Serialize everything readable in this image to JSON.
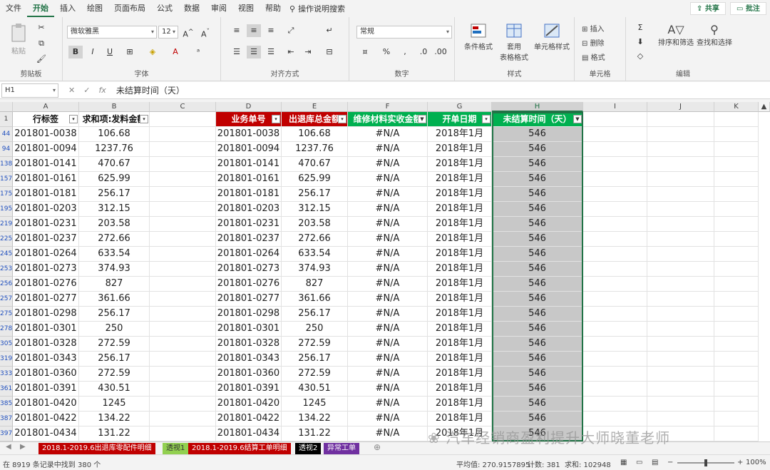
{
  "menu": {
    "items": [
      "文件",
      "开始",
      "插入",
      "绘图",
      "页面布局",
      "公式",
      "数据",
      "审阅",
      "视图",
      "帮助"
    ],
    "search": "操作说明搜索",
    "share": "共享",
    "comment": "批注"
  },
  "ribbon": {
    "paste": "粘贴",
    "font_name": "微软雅黑",
    "font_size": "12",
    "number_format": "常规",
    "cond_format": "条件格式",
    "table_format_1": "套用",
    "table_format_2": "表格格式",
    "cell_style": "单元格样式",
    "insert": "插入",
    "delete": "删除",
    "format": "格式",
    "sort_filter": "排序和筛选",
    "find_select": "查找和选择",
    "groups": {
      "clipboard": "剪贴板",
      "font": "字体",
      "alignment": "对齐方式",
      "number": "数字",
      "styles": "样式",
      "cells": "单元格",
      "editing": "编辑"
    }
  },
  "formula_bar": {
    "name_box": "H1",
    "formula": "未结算时间（天）"
  },
  "grid": {
    "columns": [
      "A",
      "B",
      "C",
      "D",
      "E",
      "F",
      "G",
      "H",
      "I",
      "J",
      "K"
    ],
    "headers": {
      "a": "行标签",
      "b": "求和项:发料金额",
      "d": "业务单号",
      "e": "出退库总金额",
      "f": "维修材料实收金额",
      "g": "开单日期",
      "h": "未结算时间（天）"
    },
    "row_numbers": [
      "1",
      "44",
      "94",
      "138",
      "157",
      "175",
      "195",
      "219",
      "225",
      "245",
      "253",
      "256",
      "257",
      "275",
      "278",
      "305",
      "319",
      "333",
      "361",
      "385",
      "387",
      "397"
    ],
    "rows": [
      {
        "a": "201801-0038",
        "b": "106.68",
        "d": "201801-0038",
        "e": "106.68",
        "f": "#N/A",
        "g": "2018年1月",
        "h": "546"
      },
      {
        "a": "201801-0094",
        "b": "1237.76",
        "d": "201801-0094",
        "e": "1237.76",
        "f": "#N/A",
        "g": "2018年1月",
        "h": "546"
      },
      {
        "a": "201801-0141",
        "b": "470.67",
        "d": "201801-0141",
        "e": "470.67",
        "f": "#N/A",
        "g": "2018年1月",
        "h": "546"
      },
      {
        "a": "201801-0161",
        "b": "625.99",
        "d": "201801-0161",
        "e": "625.99",
        "f": "#N/A",
        "g": "2018年1月",
        "h": "546"
      },
      {
        "a": "201801-0181",
        "b": "256.17",
        "d": "201801-0181",
        "e": "256.17",
        "f": "#N/A",
        "g": "2018年1月",
        "h": "546"
      },
      {
        "a": "201801-0203",
        "b": "312.15",
        "d": "201801-0203",
        "e": "312.15",
        "f": "#N/A",
        "g": "2018年1月",
        "h": "546"
      },
      {
        "a": "201801-0231",
        "b": "203.58",
        "d": "201801-0231",
        "e": "203.58",
        "f": "#N/A",
        "g": "2018年1月",
        "h": "546"
      },
      {
        "a": "201801-0237",
        "b": "272.66",
        "d": "201801-0237",
        "e": "272.66",
        "f": "#N/A",
        "g": "2018年1月",
        "h": "546"
      },
      {
        "a": "201801-0264",
        "b": "633.54",
        "d": "201801-0264",
        "e": "633.54",
        "f": "#N/A",
        "g": "2018年1月",
        "h": "546"
      },
      {
        "a": "201801-0273",
        "b": "374.93",
        "d": "201801-0273",
        "e": "374.93",
        "f": "#N/A",
        "g": "2018年1月",
        "h": "546"
      },
      {
        "a": "201801-0276",
        "b": "827",
        "d": "201801-0276",
        "e": "827",
        "f": "#N/A",
        "g": "2018年1月",
        "h": "546"
      },
      {
        "a": "201801-0277",
        "b": "361.66",
        "d": "201801-0277",
        "e": "361.66",
        "f": "#N/A",
        "g": "2018年1月",
        "h": "546"
      },
      {
        "a": "201801-0298",
        "b": "256.17",
        "d": "201801-0298",
        "e": "256.17",
        "f": "#N/A",
        "g": "2018年1月",
        "h": "546"
      },
      {
        "a": "201801-0301",
        "b": "250",
        "d": "201801-0301",
        "e": "250",
        "f": "#N/A",
        "g": "2018年1月",
        "h": "546"
      },
      {
        "a": "201801-0328",
        "b": "272.59",
        "d": "201801-0328",
        "e": "272.59",
        "f": "#N/A",
        "g": "2018年1月",
        "h": "546"
      },
      {
        "a": "201801-0343",
        "b": "256.17",
        "d": "201801-0343",
        "e": "256.17",
        "f": "#N/A",
        "g": "2018年1月",
        "h": "546"
      },
      {
        "a": "201801-0360",
        "b": "272.59",
        "d": "201801-0360",
        "e": "272.59",
        "f": "#N/A",
        "g": "2018年1月",
        "h": "546"
      },
      {
        "a": "201801-0391",
        "b": "430.51",
        "d": "201801-0391",
        "e": "430.51",
        "f": "#N/A",
        "g": "2018年1月",
        "h": "546"
      },
      {
        "a": "201801-0420",
        "b": "1245",
        "d": "201801-0420",
        "e": "1245",
        "f": "#N/A",
        "g": "2018年1月",
        "h": "546"
      },
      {
        "a": "201801-0422",
        "b": "134.22",
        "d": "201801-0422",
        "e": "134.22",
        "f": "#N/A",
        "g": "2018年1月",
        "h": "546"
      },
      {
        "a": "201801-0434",
        "b": "131.22",
        "d": "201801-0434",
        "e": "131.22",
        "f": "#N/A",
        "g": "2018年1月",
        "h": "546"
      }
    ]
  },
  "sheet_tabs": [
    {
      "label": "2018.1-2019.6出退库零配件明细",
      "bg": "#c00000",
      "fg": "#ffffff"
    },
    {
      "label": "透视1",
      "bg": "#92d050",
      "fg": "#333333"
    },
    {
      "label": "2018.1-2019.6结算工单明细",
      "bg": "#c00000",
      "fg": "#ffffff"
    },
    {
      "label": "透视2",
      "bg": "#000000",
      "fg": "#ffffff"
    },
    {
      "label": "异常工单",
      "bg": "#7030a0",
      "fg": "#ffffff"
    }
  ],
  "status": {
    "left": "在 8919 条记录中找到 380 个",
    "average": "平均值: 270.9157895",
    "count": "计数: 381",
    "sum": "求和: 102948",
    "zoom": "100%"
  },
  "watermark": "汽车经销商盈利提升大师晓董老师",
  "colors": {
    "accent": "#217346",
    "header_red": "#c00000",
    "header_green": "#00b050"
  }
}
